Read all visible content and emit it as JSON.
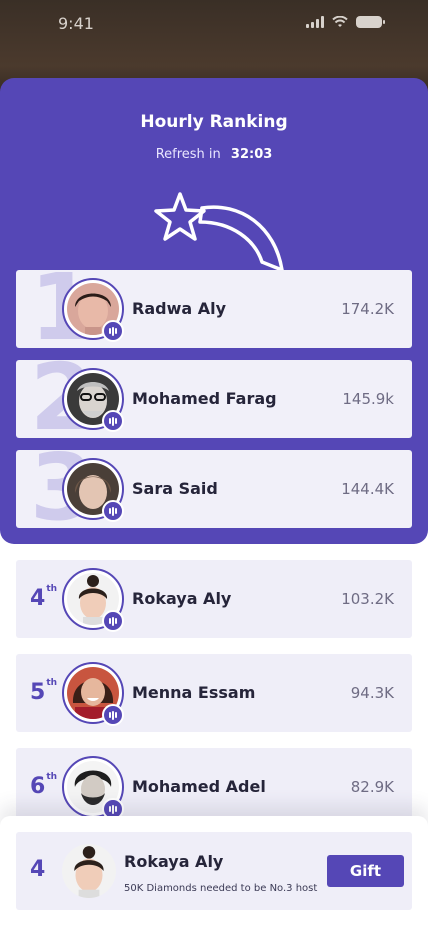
{
  "status": {
    "time": "9:41"
  },
  "header": {
    "title": "Hourly Ranking",
    "refresh_label": "Refresh in",
    "refresh_time": "32:03"
  },
  "rankings": [
    {
      "rank": "1",
      "name": "Radwa Aly",
      "score": "174.2K"
    },
    {
      "rank": "2",
      "name": "Mohamed Farag",
      "score": "145.9k"
    },
    {
      "rank": "3",
      "name": "Sara Said",
      "score": "144.4K"
    },
    {
      "rank": "4",
      "suffix": "th",
      "name": "Rokaya Aly",
      "score": "103.2K"
    },
    {
      "rank": "5",
      "suffix": "th",
      "name": "Menna Essam",
      "score": "94.3K"
    },
    {
      "rank": "6",
      "suffix": "th",
      "name": "Mohamed Adel",
      "score": "82.9K"
    }
  ],
  "footer": {
    "rank": "4",
    "name": "Rokaya Aly",
    "subtitle": "50K Diamonds needed to be No.3 host",
    "gift_label": "Gift"
  },
  "colors": {
    "accent": "#5547b6",
    "card": "#efeef8"
  }
}
